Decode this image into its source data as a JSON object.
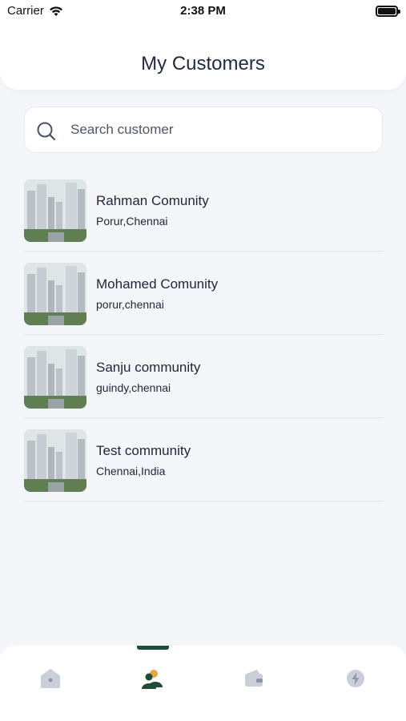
{
  "status_bar": {
    "carrier": "Carrier",
    "time": "2:38 PM"
  },
  "header": {
    "title": "My Customers"
  },
  "search": {
    "placeholder": "Search customer",
    "value": ""
  },
  "customers": [
    {
      "name": "Rahman Comunity",
      "location": "Porur,Chennai"
    },
    {
      "name": "Mohamed Comunity",
      "location": "porur,chennai"
    },
    {
      "name": "Sanju community",
      "location": "guindy,chennai"
    },
    {
      "name": "Test community",
      "location": "Chennai,India"
    }
  ],
  "tab_bar": {
    "tabs": [
      {
        "icon": "home-icon",
        "active": false
      },
      {
        "icon": "customers-icon",
        "active": true
      },
      {
        "icon": "wallet-icon",
        "active": false
      },
      {
        "icon": "bolt-icon",
        "active": false
      }
    ],
    "active_color": "#1f4d3a",
    "inactive_color": "#c9ced8"
  }
}
